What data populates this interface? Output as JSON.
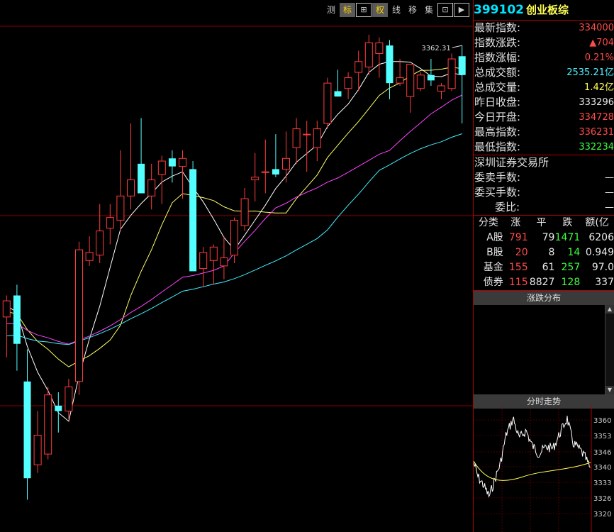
{
  "toolbar": {
    "buttons": [
      {
        "label": "测",
        "name": "measure-button"
      },
      {
        "label": "标",
        "name": "mark-button",
        "active": true
      },
      {
        "label": "⊞",
        "name": "grid-layout-button",
        "boxed": true
      },
      {
        "label": "权",
        "name": "rights-button",
        "active": true
      },
      {
        "label": "线",
        "name": "line-button"
      },
      {
        "label": "移",
        "name": "move-button"
      },
      {
        "label": "集",
        "name": "set-button"
      },
      {
        "label": "⊡",
        "name": "window-button",
        "boxed": true
      },
      {
        "label": "▶",
        "name": "next-button",
        "boxed": true
      }
    ]
  },
  "stock": {
    "code": "399102",
    "name": "创业板综"
  },
  "quote": [
    {
      "label": "最新指数:",
      "value": "334000",
      "color": "red"
    },
    {
      "label": "指数涨跌:",
      "value": "▲704",
      "color": "red"
    },
    {
      "label": "指数涨幅:",
      "value": "0.21%",
      "color": "red"
    },
    {
      "label": "总成交额:",
      "value": "2535.21亿",
      "color": "cyan"
    },
    {
      "label": "总成交量:",
      "value": "1.42亿",
      "color": "yellow"
    },
    {
      "label": "昨日收盘:",
      "value": "333296",
      "color": "white"
    },
    {
      "label": "今日开盘:",
      "value": "334728",
      "color": "red"
    },
    {
      "label": "最高指数:",
      "value": "336231",
      "color": "red"
    },
    {
      "label": "最低指数:",
      "value": "332234",
      "color": "green"
    }
  ],
  "exchange": {
    "name": "深圳证券交易所",
    "rows": [
      {
        "label": "委卖手数:",
        "value": "—"
      },
      {
        "label": "委买手数:",
        "value": "—"
      },
      {
        "label": "委比:",
        "value": "—"
      }
    ]
  },
  "stats": {
    "headers": [
      "分类",
      "涨",
      "平",
      "跌",
      "额(亿"
    ],
    "rows": [
      {
        "cat": "A股",
        "up": "791",
        "flat": "79",
        "down": "1471",
        "amt": "6206"
      },
      {
        "cat": "B股",
        "up": "20",
        "flat": "8",
        "down": "14",
        "amt": "0.949"
      },
      {
        "cat": "基金",
        "up": "155",
        "flat": "61",
        "down": "257",
        "amt": "97.0"
      },
      {
        "cat": "债券",
        "up": "115",
        "flat": "8827",
        "down": "128",
        "amt": "337"
      }
    ]
  },
  "panels": {
    "distribution": "涨跌分布",
    "intraday": "分时走势"
  },
  "chart_data": [
    {
      "type": "candlestick",
      "annotation": "3362.31",
      "candles": [
        {
          "o": 3260,
          "h": 3268,
          "l": 3245,
          "c": 3266
        },
        {
          "o": 3268,
          "h": 3272,
          "l": 3240,
          "c": 3250
        },
        {
          "o": 3236,
          "h": 3248,
          "l": 3192,
          "c": 3200
        },
        {
          "o": 3205,
          "h": 3225,
          "l": 3202,
          "c": 3216
        },
        {
          "o": 3209,
          "h": 3234,
          "l": 3207,
          "c": 3231
        },
        {
          "o": 3227,
          "h": 3232,
          "l": 3217,
          "c": 3225
        },
        {
          "o": 3225,
          "h": 3237,
          "l": 3222,
          "c": 3234
        },
        {
          "o": 3236,
          "h": 3288,
          "l": 3231,
          "c": 3285
        },
        {
          "o": 3281,
          "h": 3290,
          "l": 3279,
          "c": 3284
        },
        {
          "o": 3283,
          "h": 3302,
          "l": 3280,
          "c": 3292
        },
        {
          "o": 3293,
          "h": 3302,
          "l": 3287,
          "c": 3297
        },
        {
          "o": 3296,
          "h": 3322,
          "l": 3292,
          "c": 3305
        },
        {
          "o": 3305,
          "h": 3332,
          "l": 3300,
          "c": 3311
        },
        {
          "o": 3317,
          "h": 3334,
          "l": 3313,
          "c": 3306
        },
        {
          "o": 3305,
          "h": 3317,
          "l": 3300,
          "c": 3311
        },
        {
          "o": 3313,
          "h": 3320,
          "l": 3302,
          "c": 3318
        },
        {
          "o": 3319,
          "h": 3322,
          "l": 3310,
          "c": 3316
        },
        {
          "o": 3316,
          "h": 3322,
          "l": 3304,
          "c": 3319
        },
        {
          "o": 3315,
          "h": 3318,
          "l": 3301,
          "c": 3277
        },
        {
          "o": 3278,
          "h": 3286,
          "l": 3271,
          "c": 3284
        },
        {
          "o": 3281,
          "h": 3287,
          "l": 3272,
          "c": 3286
        },
        {
          "o": 3279,
          "h": 3290,
          "l": 3274,
          "c": 3282
        },
        {
          "o": 3283,
          "h": 3297,
          "l": 3280,
          "c": 3296
        },
        {
          "o": 3294,
          "h": 3308,
          "l": 3292,
          "c": 3304
        },
        {
          "o": 3311,
          "h": 3321,
          "l": 3303,
          "c": 3312
        },
        {
          "o": 3314,
          "h": 3326,
          "l": 3306,
          "c": 3314
        },
        {
          "o": 3315,
          "h": 3328,
          "l": 3312,
          "c": 3313
        },
        {
          "o": 3315,
          "h": 3329,
          "l": 3310,
          "c": 3319
        },
        {
          "o": 3323,
          "h": 3334,
          "l": 3317,
          "c": 3330
        },
        {
          "o": 3328,
          "h": 3333,
          "l": 3314,
          "c": 3328
        },
        {
          "o": 3323,
          "h": 3333,
          "l": 3318,
          "c": 3330
        },
        {
          "o": 3332,
          "h": 3349,
          "l": 3330,
          "c": 3347
        },
        {
          "o": 3344,
          "h": 3352,
          "l": 3342,
          "c": 3342
        },
        {
          "o": 3345,
          "h": 3351,
          "l": 3341,
          "c": 3349
        },
        {
          "o": 3351,
          "h": 3359,
          "l": 3344,
          "c": 3355
        },
        {
          "o": 3353,
          "h": 3365,
          "l": 3350,
          "c": 3362
        },
        {
          "o": 3358,
          "h": 3364,
          "l": 3349,
          "c": 3362
        },
        {
          "o": 3361,
          "h": 3363,
          "l": 3341,
          "c": 3347
        },
        {
          "o": 3347,
          "h": 3356,
          "l": 3346,
          "c": 3349
        },
        {
          "o": 3342,
          "h": 3354,
          "l": 3336,
          "c": 3354
        },
        {
          "o": 3345,
          "h": 3351,
          "l": 3344,
          "c": 3350
        },
        {
          "o": 3350,
          "h": 3356,
          "l": 3346,
          "c": 3348
        },
        {
          "o": 3344,
          "h": 3347,
          "l": 3341,
          "c": 3346
        },
        {
          "o": 3345,
          "h": 3358,
          "l": 3344,
          "c": 3356
        },
        {
          "o": 3357,
          "h": 3361,
          "l": 3332,
          "c": 3350
        }
      ]
    },
    {
      "type": "line",
      "ylabels": [
        "3360",
        "3353",
        "3346",
        "3340",
        "3333",
        "3326",
        "3320"
      ]
    }
  ]
}
